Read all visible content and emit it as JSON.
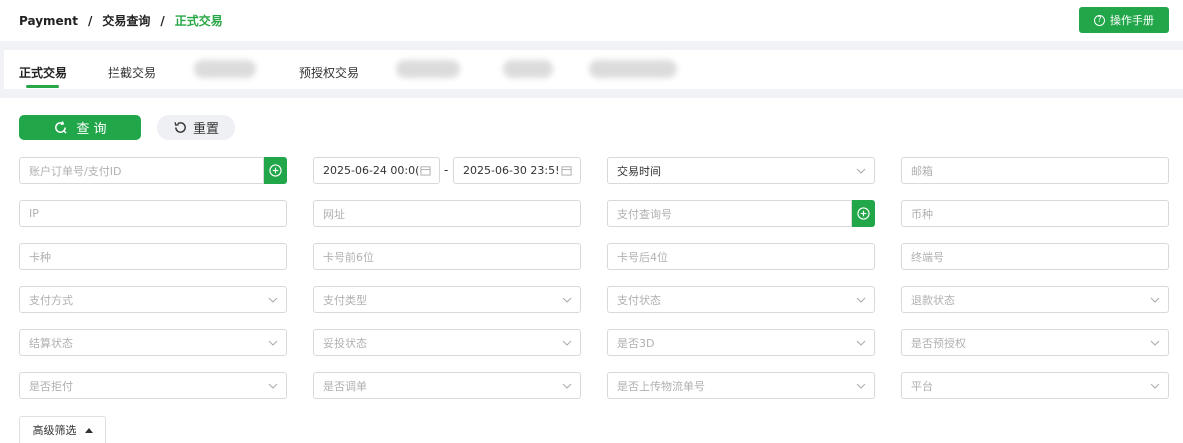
{
  "breadcrumb": {
    "root": "Payment",
    "parent": "交易查询",
    "current": "正式交易",
    "separator": "/"
  },
  "manual_button": {
    "label": "操作手册",
    "icon": "question-circle-icon"
  },
  "tabs": [
    {
      "label": "正式交易",
      "active": true
    },
    {
      "label": "拦截交易",
      "active": false
    },
    {
      "label": "预授权交易",
      "active": false
    }
  ],
  "actions": {
    "search_label": "查 询",
    "reset_label": "重置"
  },
  "colors": {
    "accent": "#21a649",
    "active_text": "#27a745"
  },
  "filters": {
    "account_order": {
      "placeholder": "账户订单号/支付ID"
    },
    "date_start": {
      "value": "2025-06-24 00:0("
    },
    "date_end": {
      "value": "2025-06-30 23:5!"
    },
    "range_sep": "-",
    "time_type": {
      "value": "交易时间"
    },
    "email": {
      "placeholder": "邮箱"
    },
    "ip": {
      "placeholder": "IP"
    },
    "url": {
      "placeholder": "网址"
    },
    "pay_query_no": {
      "placeholder": "支付查询号"
    },
    "currency": {
      "placeholder": "币种"
    },
    "card_type": {
      "placeholder": "卡种"
    },
    "card_first6": {
      "placeholder": "卡号前6位"
    },
    "card_last4": {
      "placeholder": "卡号后4位"
    },
    "terminal_no": {
      "placeholder": "终端号"
    },
    "pay_method": {
      "placeholder": "支付方式"
    },
    "pay_type": {
      "placeholder": "支付类型"
    },
    "pay_status": {
      "placeholder": "支付状态"
    },
    "refund_status": {
      "placeholder": "退款状态"
    },
    "settle_status": {
      "placeholder": "结算状态"
    },
    "complaint_status": {
      "placeholder": "妥投状态"
    },
    "is_3d": {
      "placeholder": "是否3D"
    },
    "is_preauth": {
      "placeholder": "是否预授权"
    },
    "is_chargeback": {
      "placeholder": "是否拒付"
    },
    "is_adjusted": {
      "placeholder": "是否调单"
    },
    "is_tracking_uploaded": {
      "placeholder": "是否上传物流单号"
    },
    "platform": {
      "placeholder": "平台"
    }
  },
  "advanced_filter": {
    "label": "高级筛选"
  }
}
